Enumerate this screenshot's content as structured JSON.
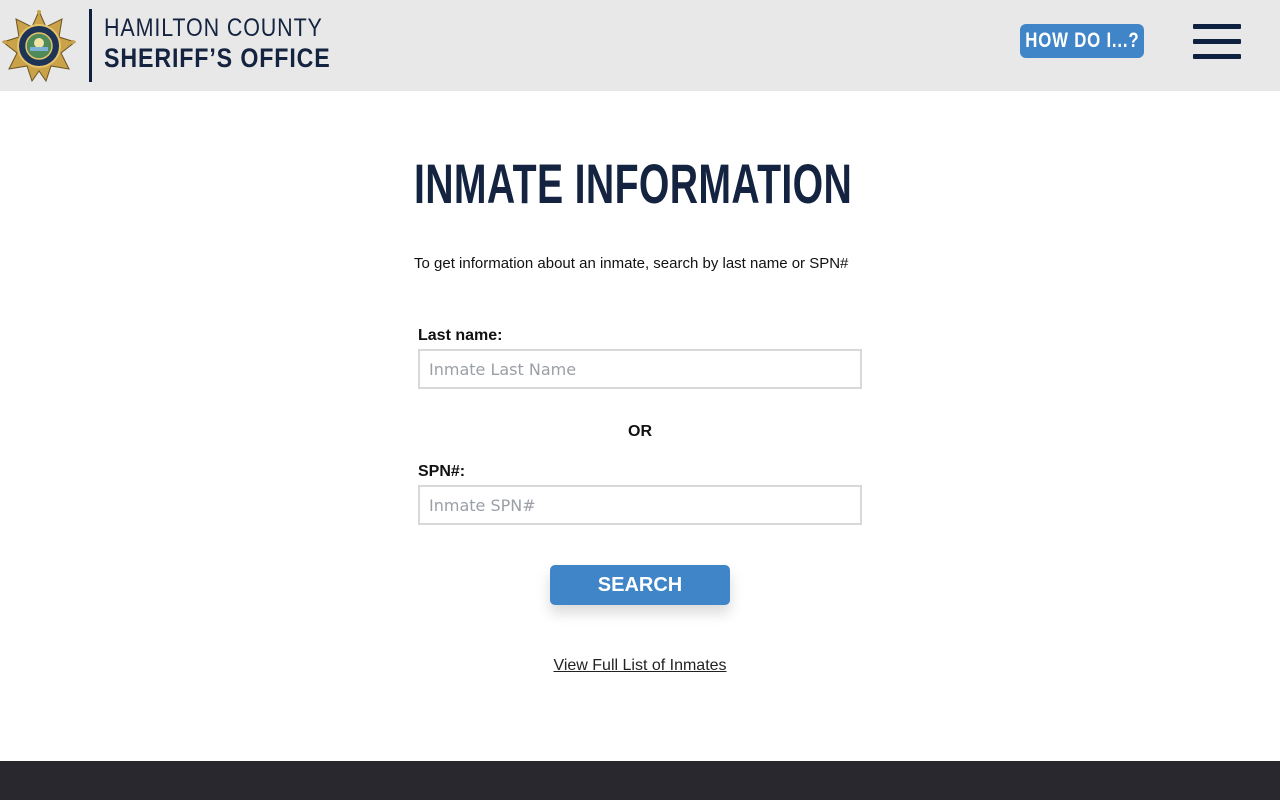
{
  "header": {
    "org_line1": "HAMILTON COUNTY",
    "org_line2": "SHERIFF’S OFFICE",
    "howdo_label": "HOW DO I...?",
    "logo_icon": "sheriff-star-badge-icon",
    "menu_icon": "hamburger-menu-icon"
  },
  "main": {
    "title": "INMATE INFORMATION",
    "intro": "To get information about an inmate, search by last name or SPN#",
    "lastname_label": "Last name:",
    "lastname_placeholder": "Inmate Last Name",
    "lastname_value": "",
    "or_label": "OR",
    "spn_label": "SPN#:",
    "spn_placeholder": "Inmate SPN#",
    "spn_value": "",
    "search_label": "SEARCH",
    "view_all_label": "View Full List of Inmates"
  },
  "colors": {
    "header_bg": "#e8e8e8",
    "navy": "#14233f",
    "accent_blue": "#3f85c8",
    "footer_bg": "#28282e"
  }
}
